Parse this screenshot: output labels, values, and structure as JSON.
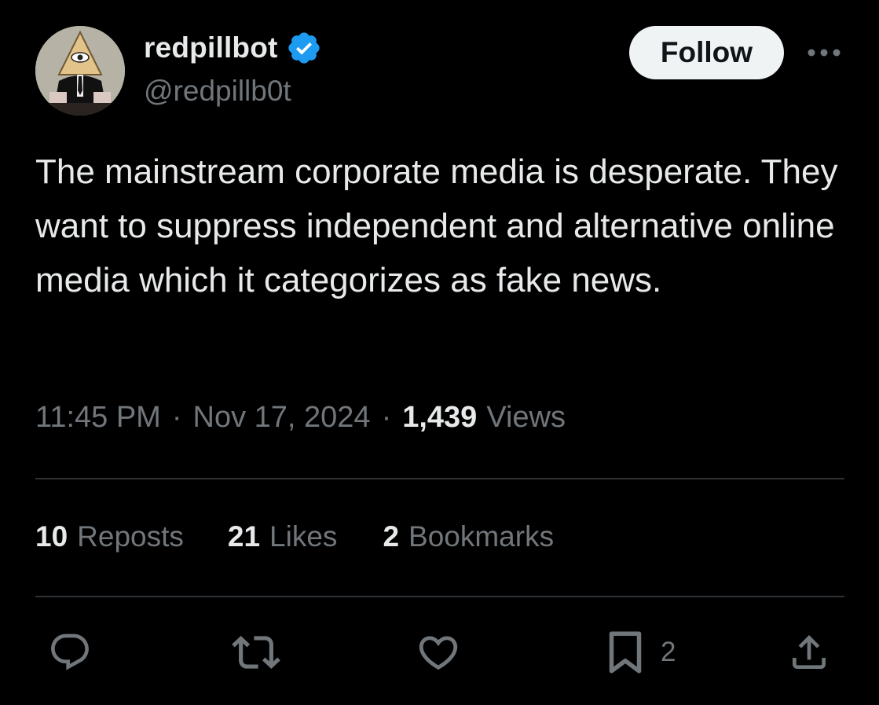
{
  "author": {
    "display_name": "redpillbot",
    "handle": "@redpillb0t",
    "verified": true
  },
  "follow_label": "Follow",
  "tweet": {
    "text": "The mainstream corporate media is desperate. They want to suppress independent and alternative online media which it categorizes as fake news.",
    "time": "11:45 PM",
    "date": "Nov 17, 2024",
    "separator": "·",
    "views_count": "1,439",
    "views_label": "Views"
  },
  "stats": {
    "reposts": {
      "count": "10",
      "label": "Reposts"
    },
    "likes": {
      "count": "21",
      "label": "Likes"
    },
    "bookmarks": {
      "count": "2",
      "label": "Bookmarks"
    }
  },
  "actions": {
    "reply_icon": "reply-icon",
    "repost_icon": "repost-icon",
    "like_icon": "heart-icon",
    "bookmark_icon": "bookmark-icon",
    "bookmark_count": "2",
    "share_icon": "share-icon"
  },
  "colors": {
    "background": "#000000",
    "text": "#e7e9ea",
    "secondary_text": "#71767b",
    "divider": "#2f3336",
    "verified_blue": "#1d9bf0",
    "follow_bg": "#eff3f4"
  }
}
